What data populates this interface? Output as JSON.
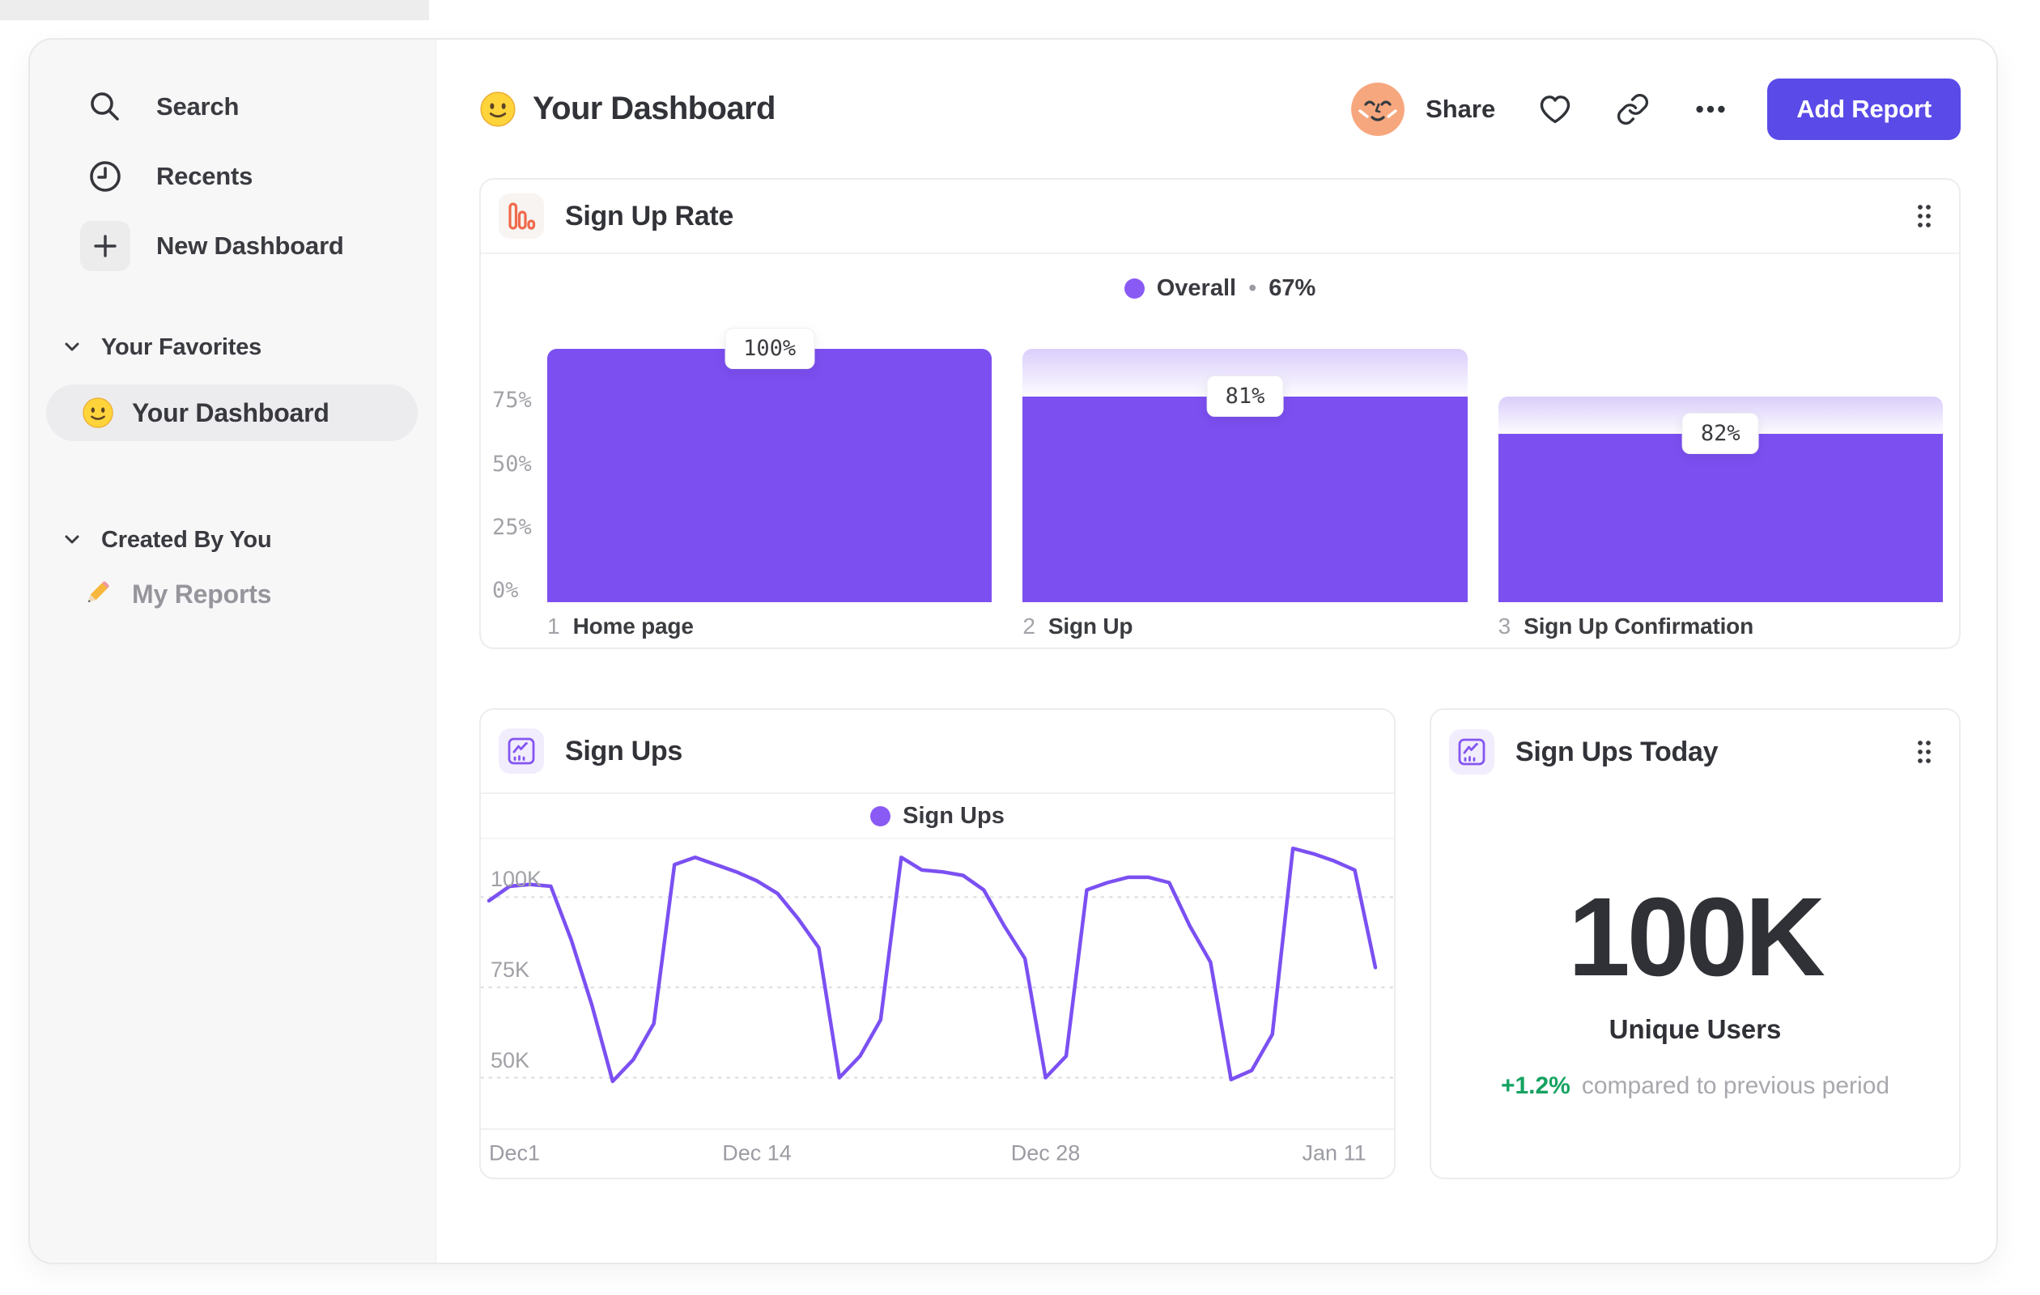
{
  "sidebar": {
    "nav": [
      {
        "label": "Search",
        "icon": "search"
      },
      {
        "label": "Recents",
        "icon": "clock"
      },
      {
        "label": "New Dashboard",
        "icon": "plus"
      }
    ],
    "sections": [
      {
        "title": "Your Favorites",
        "items": [
          {
            "label": "Your Dashboard",
            "emoji": "smiley",
            "active": true
          }
        ]
      },
      {
        "title": "Created By You",
        "items": [
          {
            "label": "My Reports",
            "emoji": "pencil",
            "active": false
          }
        ]
      }
    ]
  },
  "header": {
    "title": "Your Dashboard",
    "share_label": "Share",
    "add_report_label": "Add Report"
  },
  "colors": {
    "accent_purple": "#7C4FF0",
    "button_purple": "#5A4BE8",
    "legend_dot": "#8A5AF5",
    "line_purple": "#7B50F2",
    "delta_green": "#15A261",
    "funnel_icon_orange": "#F0694B"
  },
  "chart_data": [
    {
      "type": "bar",
      "variant": "funnel",
      "title": "Sign Up Rate",
      "legend": {
        "label": "Overall",
        "separator": "•",
        "value": "67%"
      },
      "ylim": [
        0,
        100
      ],
      "y_ticks": [
        {
          "label": "75%",
          "value": 75
        },
        {
          "label": "50%",
          "value": 50
        },
        {
          "label": "25%",
          "value": 25
        },
        {
          "label": "0%",
          "value": 0
        }
      ],
      "steps": [
        {
          "index": "1",
          "label": "Home page",
          "display": "100%",
          "pct_of_previous": 100,
          "pct_of_total": 100
        },
        {
          "index": "2",
          "label": "Sign Up",
          "display": "81%",
          "pct_of_previous": 81,
          "pct_of_total": 81
        },
        {
          "index": "3",
          "label": "Sign Up Confirmation",
          "display": "82%",
          "pct_of_previous": 82,
          "pct_of_total": 66.4
        }
      ]
    },
    {
      "type": "line",
      "title": "Sign Ups",
      "legend": {
        "label": "Sign Ups"
      },
      "x_ticks": [
        {
          "label": "Dec1",
          "day": 0
        },
        {
          "label": "Dec 14",
          "day": 13
        },
        {
          "label": "Dec 28",
          "day": 27
        },
        {
          "label": "Jan 11",
          "day": 41
        }
      ],
      "y_ticks": [
        {
          "label": "100K",
          "value": 100
        },
        {
          "label": "75K",
          "value": 75
        },
        {
          "label": "50K",
          "value": 50
        }
      ],
      "ylim_thousands": [
        36,
        116
      ],
      "unit": "thousands of sign ups per day",
      "values_thousands": [
        99,
        103,
        103.5,
        103,
        88,
        70,
        49,
        55,
        65,
        109,
        111,
        109,
        107,
        104.5,
        101,
        94,
        86,
        50,
        56,
        66,
        111,
        107.5,
        107,
        106,
        102,
        92,
        83,
        50,
        56,
        102,
        104,
        105.5,
        105.5,
        104,
        92,
        82,
        49.5,
        52,
        62,
        113.5,
        112,
        110,
        107.5,
        80.5
      ]
    },
    {
      "type": "big-number",
      "title": "Sign Ups Today",
      "value": "100K",
      "label": "Unique Users",
      "delta": "+1.2%",
      "comparison": "compared to previous period"
    }
  ]
}
